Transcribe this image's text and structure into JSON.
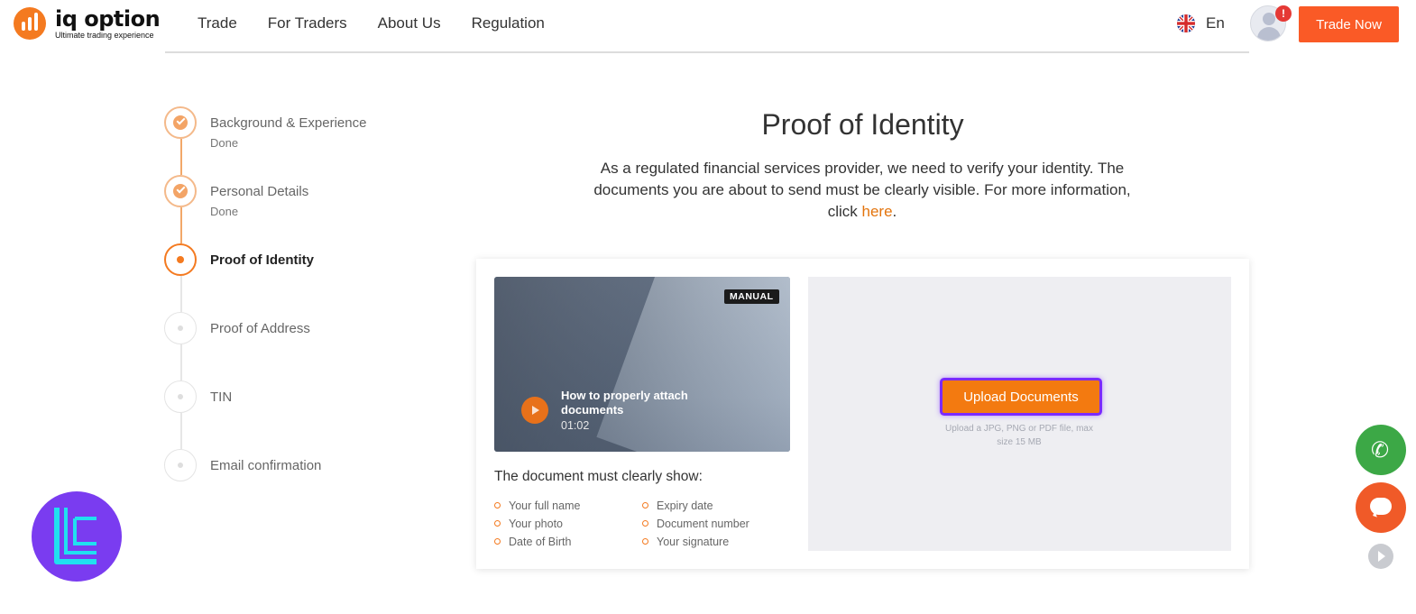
{
  "brand": {
    "name": "iq option",
    "tagline": "Ultimate trading experience",
    "accent": "#f47a20"
  },
  "nav": {
    "items": [
      {
        "label": "Trade"
      },
      {
        "label": "For Traders"
      },
      {
        "label": "About Us"
      },
      {
        "label": "Regulation"
      }
    ],
    "language": "En",
    "alert_badge": "!",
    "trade_now": "Trade Now"
  },
  "steps": [
    {
      "title": "Background & Experience",
      "subtitle": "Done",
      "status": "done"
    },
    {
      "title": "Personal Details",
      "subtitle": "Done",
      "status": "done"
    },
    {
      "title": "Proof of Identity",
      "subtitle": "",
      "status": "active"
    },
    {
      "title": "Proof of Address",
      "subtitle": "",
      "status": "pending"
    },
    {
      "title": "TIN",
      "subtitle": "",
      "status": "pending"
    },
    {
      "title": "Email confirmation",
      "subtitle": "",
      "status": "pending"
    }
  ],
  "main": {
    "title": "Proof of Identity",
    "intro_before_link": "As a regulated financial services provider, we need to verify your identity. The documents you are about to send must be clearly visible. For more information, click ",
    "intro_link": "here",
    "intro_after_link": "."
  },
  "video": {
    "badge": "MANUAL",
    "title": "How to properly attach documents",
    "duration": "01:02"
  },
  "requirements": {
    "title": "The document must clearly show:",
    "left": [
      "Your full name",
      "Your photo",
      "Date of Birth"
    ],
    "right": [
      "Expiry date",
      "Document number",
      "Your signature"
    ]
  },
  "upload": {
    "button": "Upload Documents",
    "hint": "Upload a JPG, PNG or PDF file, max size 15 MB"
  },
  "icons": {
    "phone": "phone-icon",
    "chat": "chat-icon",
    "expand": "chevron-right-icon"
  }
}
